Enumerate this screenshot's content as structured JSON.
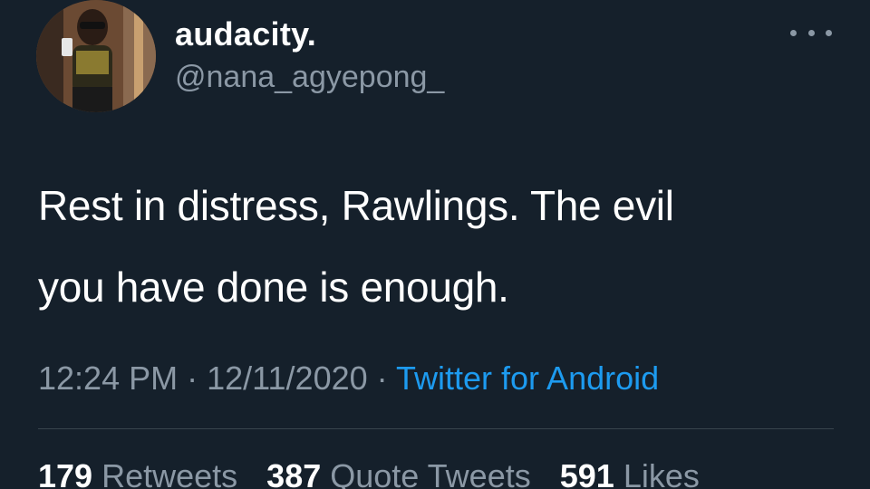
{
  "tweet": {
    "display_name": "audacity.",
    "handle": "@nana_agyepong_",
    "text_line1": "Rest in distress, Rawlings. The evil",
    "text_line2": "you have done is enough.",
    "time": "12:24 PM",
    "separator": "·",
    "date": "12/11/2020",
    "source": "Twitter for Android",
    "stats": {
      "retweets_count": "179",
      "retweets_label": "Retweets",
      "quote_tweets_count": "387",
      "quote_tweets_label": "Quote Tweets",
      "likes_count": "591",
      "likes_label": "Likes"
    }
  },
  "icons": {
    "more": "more-horizontal-icon"
  },
  "colors": {
    "background": "#15202b",
    "text": "#ffffff",
    "secondary": "#8b98a5",
    "link": "#1d9bf0",
    "divider": "#38444d"
  }
}
